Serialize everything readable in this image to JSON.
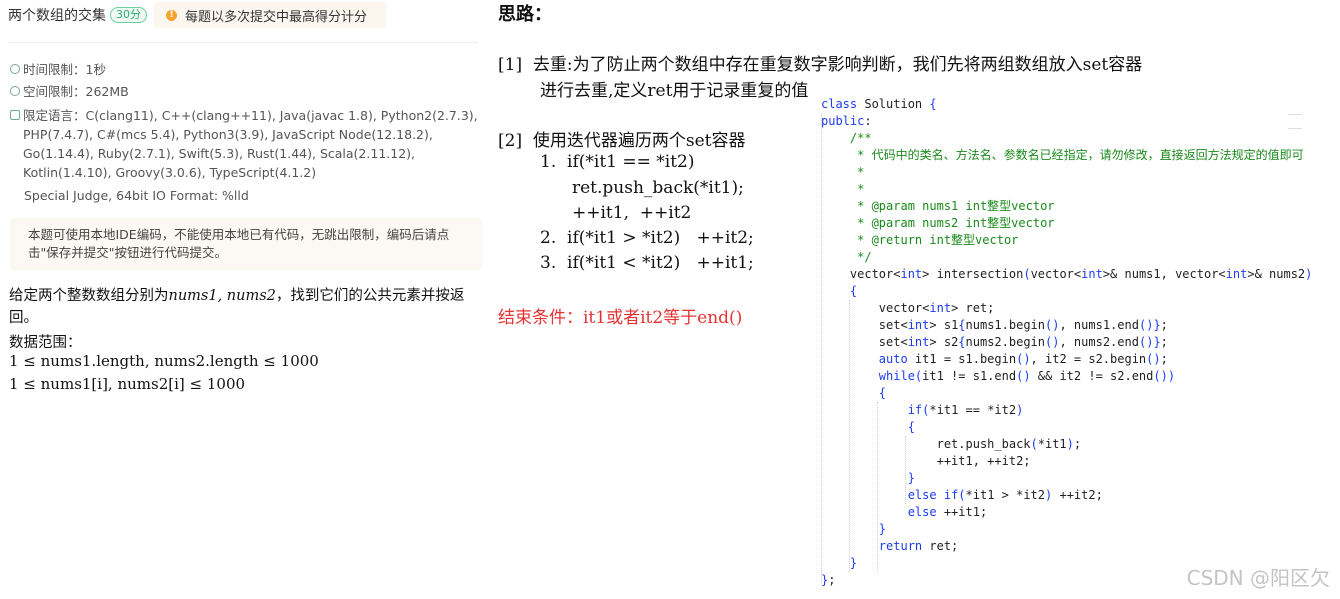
{
  "problem": {
    "title": "两个数组的交集",
    "score": "30分",
    "notice": "每题以多次提交中最高得分计分",
    "time_limit": "时间限制：1秒",
    "space_limit": "空间限制：262MB",
    "languages": "限定语言：C(clang11), C++(clang++11), Java(javac 1.8), Python2(2.7.3), PHP(7.4.7), C#(mcs 5.4), Python3(3.9), JavaScript Node(12.18.2), Go(1.14.4), Ruby(2.7.1), Swift(5.3), Rust(1.44), Scala(2.11.12), Kotlin(1.4.10), Groovy(3.0.6), TypeScript(4.1.2)",
    "judge": "Special Judge, 64bit IO Format: %lld",
    "tip": "本题可使用本地IDE编码，不能使用本地已有代码，无跳出限制，编码后请点击\"保存并提交\"按钮进行代码提交。",
    "desc_prefix": "给定两个整数数组分别为",
    "desc_vars": "nums1, nums2",
    "desc_suffix": "，找到它们的公共元素并按返回。",
    "range_label": "数据范围：",
    "range_1": "1 ≤ nums1.length, nums2.length ≤ 1000",
    "range_2": "1 ≤ nums1[i], nums2[i] ≤ 1000"
  },
  "notes": {
    "title": "思路：",
    "step1_line1": "[1]  去重:为了防止两个数组中存在重复数字影响判断，我们先将两组数组放入set容器",
    "step1_line2": "进行去重,定义ret用于记录重复的值",
    "step2_title": "[2]  使用迭代器遍历两个set容器",
    "step2_a1": "1.  if(*it1 == *it2)",
    "step2_a2": "ret.push_back(*it1);",
    "step2_a3": "++it1,  ++it2",
    "step2_b": "2.  if(*it1 > *it2)   ++it2;",
    "step2_c": "3.  if(*it1 < *it2)   ++it1;",
    "end_condition": "结束条件：it1或者it2等于end()"
  },
  "code": {
    "lines": [
      "class Solution {",
      "public:",
      "    /**",
      "     * 代码中的类名、方法名、参数名已经指定，请勿修改，直接返回方法规定的值即可",
      "     *",
      "     *",
      "     * @param nums1 int整型vector",
      "     * @param nums2 int整型vector",
      "     * @return int整型vector",
      "     */",
      "    vector<int> intersection(vector<int>& nums1, vector<int>& nums2)",
      "    {",
      "        vector<int> ret;",
      "        set<int> s1{nums1.begin(), nums1.end()};",
      "        set<int> s2{nums2.begin(), nums2.end()};",
      "        auto it1 = s1.begin(), it2 = s2.begin();",
      "        while(it1 != s1.end() && it2 != s2.end())",
      "        {",
      "            if(*it1 == *it2)",
      "            {",
      "                ret.push_back(*it1);",
      "                ++it1, ++it2;",
      "            }",
      "            else if(*it1 > *it2) ++it2;",
      "            else ++it1;",
      "        }",
      "        return ret;",
      "    }",
      "};"
    ]
  },
  "watermark": "CSDN @阳区欠"
}
